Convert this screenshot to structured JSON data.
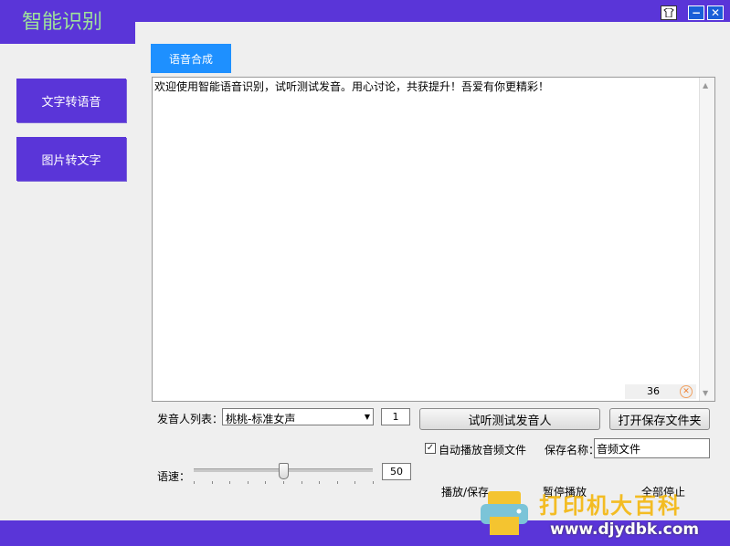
{
  "window": {
    "title": "智能识别"
  },
  "nav": [
    {
      "label": "文字转语音"
    },
    {
      "label": "图片转文字"
    }
  ],
  "tab": {
    "label": "语音合成"
  },
  "editor": {
    "text": "欢迎使用智能语音识别，试听测试发音。用心讨论，共获提升！吾爱有你更精彩！",
    "char_count": "36"
  },
  "voice": {
    "label": "发音人列表：",
    "selected": "桃桃-标准女声",
    "count": "1",
    "test_button": "试听测试发音人",
    "open_folder_button": "打开保存文件夹"
  },
  "options": {
    "autoplay_label": "自动播放音频文件",
    "autoplay_checked": true,
    "save_name_label": "保存名称：",
    "save_name_value": "音频文件"
  },
  "speed": {
    "label": "语速：",
    "value": "50",
    "slider_fraction": 0.5
  },
  "actions": {
    "play_save": "播放/保存",
    "pause": "暂停播放",
    "stop_all": "全部停止"
  },
  "watermark": {
    "line1": "打印机大百科",
    "line2": "www.djydbk.com"
  },
  "colors": {
    "accent": "#5a35d8",
    "tab": "#1e90ff",
    "title_text": "#9fe39a"
  }
}
